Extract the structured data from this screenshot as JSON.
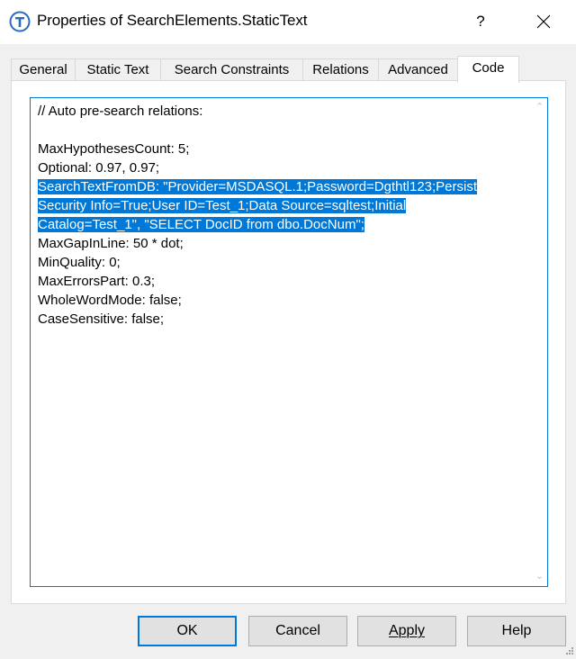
{
  "window": {
    "title": "Properties of SearchElements.StaticText",
    "help_label": "?",
    "icon": "app-t-icon"
  },
  "tabs": [
    {
      "label": "General",
      "active": false
    },
    {
      "label": "Static Text",
      "active": false
    },
    {
      "label": "Search Constraints",
      "active": false
    },
    {
      "label": "Relations",
      "active": false
    },
    {
      "label": "Advanced",
      "active": false
    },
    {
      "label": "Code",
      "active": true
    }
  ],
  "code": {
    "lines": [
      "// Auto pre-search relations:",
      "",
      "MaxHypothesesCount: 5;",
      "Optional: 0.97, 0.97;",
      "SearchTextFromDB: \"Provider=MSDASQL.1;Password=Dgthtl123;Persist",
      "Security Info=True;User ID=Test_1;Data Source=sqltest;Initial",
      "Catalog=Test_1\", \"SELECT DocID from dbo.DocNum\";",
      "MaxGapInLine: 50 * dot;",
      "MinQuality: 0;",
      "MaxErrorsPart: 0.3;",
      "WholeWordMode: false;",
      "CaseSensitive: false;"
    ],
    "selected_lines": [
      4,
      5,
      6
    ]
  },
  "buttons": {
    "ok": "OK",
    "cancel": "Cancel",
    "apply": "Apply",
    "help": "Help"
  },
  "colors": {
    "accent": "#0078d7",
    "selection_text": "#ffffff"
  }
}
